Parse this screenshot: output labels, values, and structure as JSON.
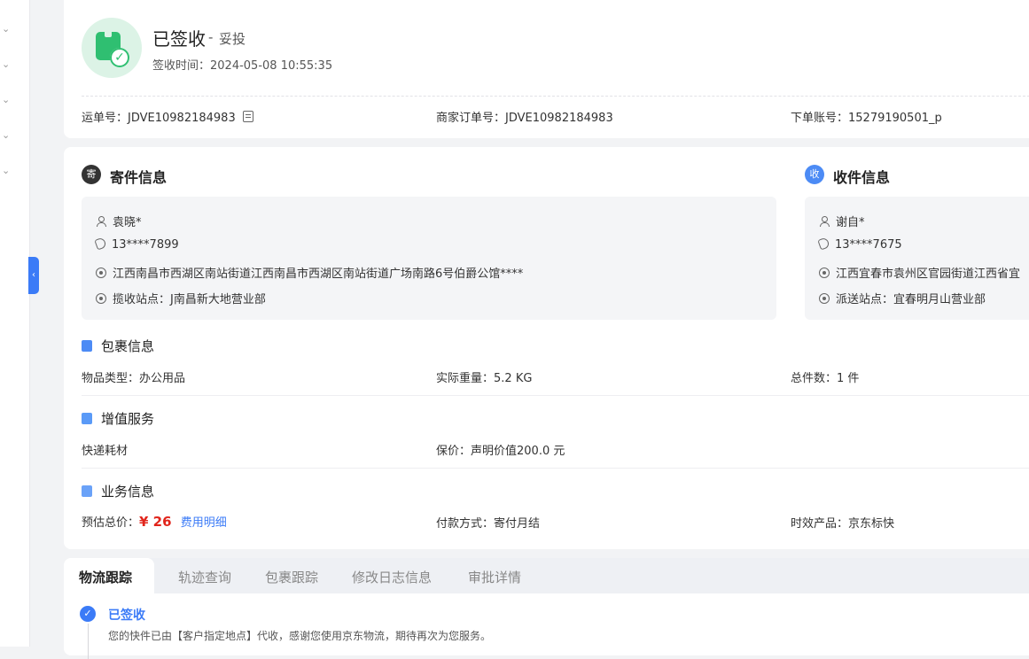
{
  "header": {
    "status": "已签收",
    "status_sub": "妥投",
    "sign_time_label": "签收时间：",
    "sign_time": "2024-05-08 10:55:35",
    "waybill_label": "运单号：",
    "waybill": "JDVE10982184983",
    "merchant_order_label": "商家订单号：",
    "merchant_order": "JDVE10982184983",
    "account_label": "下单账号：",
    "account": "15279190501_p"
  },
  "sender": {
    "badge": "寄",
    "title": "寄件信息",
    "name": "袁晓*",
    "phone": "13****7899",
    "address": "江西南昌市西湖区南站街道江西南昌市西湖区南站街道广场南路6号伯爵公馆****",
    "station_label": "揽收站点：",
    "station": "J南昌新大地营业部"
  },
  "receiver": {
    "badge": "收",
    "title": "收件信息",
    "name": "谢自*",
    "phone": "13****7675",
    "address": "江西宜春市袁州区官园街道江西省宜",
    "station_label": "派送站点：",
    "station": "宜春明月山营业部"
  },
  "package": {
    "title": "包裹信息",
    "type_label": "物品类型：",
    "type": "办公用品",
    "weight_label": "实际重量：",
    "weight": "5.2 KG",
    "count_label": "总件数：",
    "count": "1 件"
  },
  "value_added": {
    "title": "增值服务",
    "material": "快递耗材",
    "insure_label": "保价：",
    "insure": "声明价值200.0 元"
  },
  "business": {
    "title": "业务信息",
    "price_label": "预估总价：",
    "price": "¥ 26",
    "fee_detail": "费用明细",
    "pay_label": "付款方式：",
    "pay": "寄付月结",
    "product_label": "时效产品：",
    "product": "京东标快"
  },
  "tabs": [
    "物流跟踪",
    "轨迹查询",
    "包裹跟踪",
    "修改日志信息",
    "审批详情"
  ],
  "tracking": {
    "status": "已签收",
    "desc": "您的快件已由【客户指定地点】代收，感谢您使用京东物流，期待再次为您服务。"
  },
  "colors": {
    "accent": "#3b7bf7",
    "success": "#2fbf71",
    "price": "#e1251b"
  },
  "icons": [
    "package-check-icon",
    "copy-icon",
    "person-icon",
    "phone-icon",
    "location-icon",
    "chevron-down-icon",
    "collapse-arrow-icon"
  ]
}
